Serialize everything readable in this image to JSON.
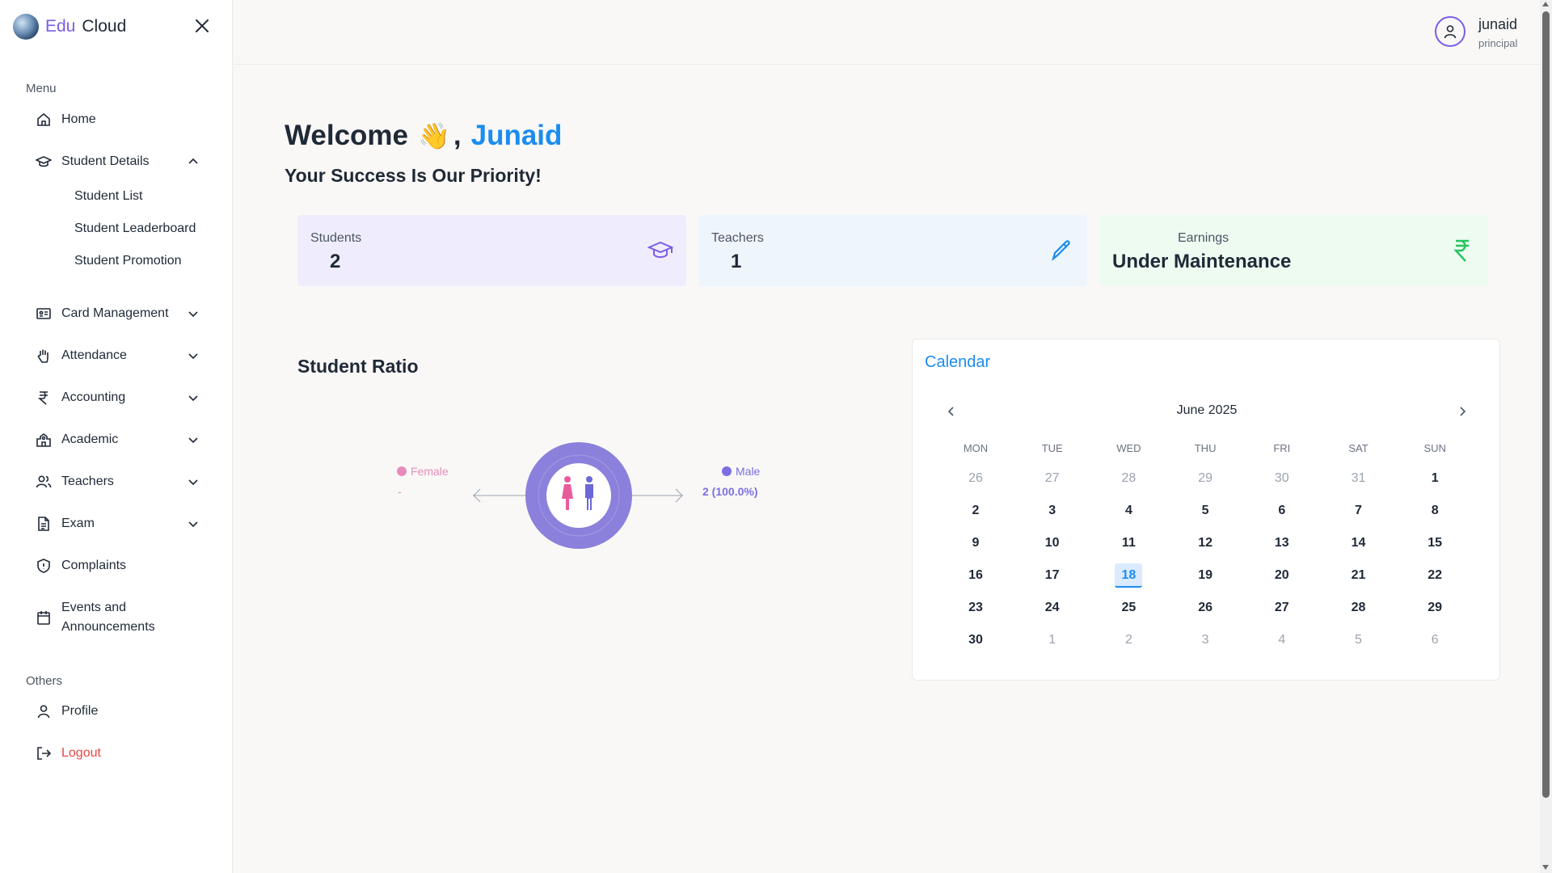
{
  "brand": {
    "edu": "Edu",
    "cloud": "Cloud"
  },
  "sidebar": {
    "menu_label": "Menu",
    "others_label": "Others",
    "items": [
      {
        "label": "Home",
        "icon": "home-icon"
      },
      {
        "label": "Student Details",
        "icon": "graduation-cap-icon",
        "expanded": true,
        "children": [
          "Student List",
          "Student Leaderboard",
          "Student Promotion"
        ]
      },
      {
        "label": "Card Management",
        "icon": "id-card-icon"
      },
      {
        "label": "Attendance",
        "icon": "hand-icon"
      },
      {
        "label": "Accounting",
        "icon": "rupee-icon"
      },
      {
        "label": "Academic",
        "icon": "school-icon"
      },
      {
        "label": "Teachers",
        "icon": "users-icon"
      },
      {
        "label": "Exam",
        "icon": "document-icon"
      },
      {
        "label": "Complaints",
        "icon": "shield-icon"
      },
      {
        "label": "Events and\nAnnouncements",
        "icon": "calendar-icon"
      }
    ],
    "others": [
      {
        "label": "Profile",
        "icon": "user-icon"
      },
      {
        "label": "Logout",
        "icon": "logout-icon"
      }
    ]
  },
  "user": {
    "name": "junaid",
    "role": "principal"
  },
  "welcome": {
    "greeting": "Welcome",
    "wave": "👋",
    "comma": ",",
    "name": "Junaid",
    "tagline": "Your Success Is Our Priority!"
  },
  "stats": {
    "students": {
      "label": "Students",
      "value": "2"
    },
    "teachers": {
      "label": "Teachers",
      "value": "1"
    },
    "earnings": {
      "label": "Earnings",
      "value": "Under Maintenance"
    }
  },
  "ratio": {
    "title": "Student Ratio",
    "female_label": "Female",
    "female_value": "-",
    "male_label": "Male",
    "male_value": "2 (100.0%)"
  },
  "calendar": {
    "title": "Calendar",
    "month": "June 2025",
    "dow": [
      "MON",
      "TUE",
      "WED",
      "THU",
      "FRI",
      "SAT",
      "SUN"
    ],
    "weeks": [
      [
        "26",
        "27",
        "28",
        "29",
        "30",
        "31",
        "1"
      ],
      [
        "2",
        "3",
        "4",
        "5",
        "6",
        "7",
        "8"
      ],
      [
        "9",
        "10",
        "11",
        "12",
        "13",
        "14",
        "15"
      ],
      [
        "16",
        "17",
        "18",
        "19",
        "20",
        "21",
        "22"
      ],
      [
        "23",
        "24",
        "25",
        "26",
        "27",
        "28",
        "29"
      ],
      [
        "30",
        "1",
        "2",
        "3",
        "4",
        "5",
        "6"
      ]
    ],
    "today": "18"
  },
  "colors": {
    "accent": "#7c5ce6",
    "blue": "#1b8cf0",
    "female": "#e88bbb",
    "male": "#7c6fe3",
    "logout": "#ef4444",
    "earnings_icon": "#22c55e"
  }
}
